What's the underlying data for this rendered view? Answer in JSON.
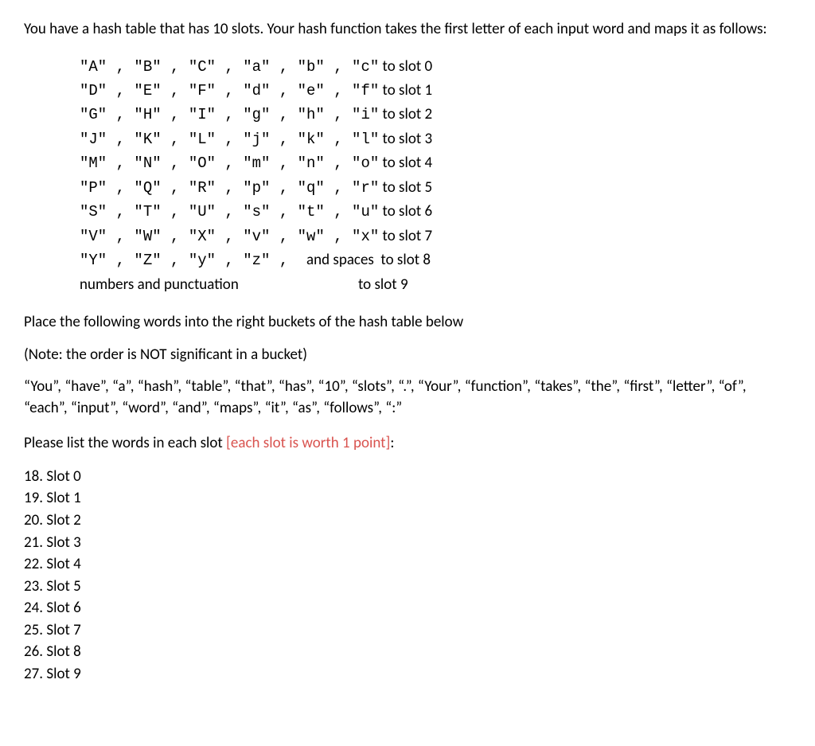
{
  "intro": "You have a hash table that has 10 slots.  Your hash function takes the first letter of each input word and maps it as follows:",
  "mapping": [
    {
      "chars": "\"A\" , \"B\" , \"C\" , \"a\" , \"b\" , \"c\"",
      "target": " to slot 0"
    },
    {
      "chars": "\"D\" , \"E\" , \"F\" , \"d\" , \"e\" , \"f\"",
      "target": " to slot 1"
    },
    {
      "chars": "\"G\" , \"H\" , \"I\" , \"g\" , \"h\" , \"i\"",
      "target": " to slot 2"
    },
    {
      "chars": "\"J\" , \"K\" , \"L\" , \"j\" , \"k\" , \"l\"",
      "target": " to slot 3"
    },
    {
      "chars": "\"M\" , \"N\" , \"O\" , \"m\" , \"n\" , \"o\"",
      "target": " to slot 4"
    },
    {
      "chars": "\"P\" , \"Q\" , \"R\" , \"p\" , \"q\" , \"r\"",
      "target": " to slot 5"
    },
    {
      "chars": "\"S\" , \"T\" , \"U\" , \"s\" , \"t\" , \"u\"",
      "target": " to slot 6"
    },
    {
      "chars": "\"V\" , \"W\" , \"X\" , \"v\" , \"w\" , \"x\"",
      "target": " to slot 7"
    }
  ],
  "mapping_row_8": {
    "chars": "\"Y\" , \"Z\" , \"y\" , \"z\" ,  ",
    "extra": "and spaces",
    "target": "  to slot 8"
  },
  "mapping_row_9": {
    "text": "numbers and punctuation",
    "target": "to slot 9"
  },
  "instruction1": "Place the following words into the right buckets of the hash table below",
  "instruction2": "(Note: the order is NOT significant in a bucket)",
  "words": "“You”, “have”, “a”, “hash”, “table”, “that”, “has”, “10”, “slots”, “.”, “Your”, “function”, “takes”, “the”, “first”, “letter”, “of”, “each”, “input”, “word”, “and”, “maps”, “it”, “as”, “follows”, “:”",
  "prompt_prefix": "Please list the words in each slot ",
  "prompt_highlight": "[each slot is worth 1 point]",
  "prompt_suffix": ":",
  "slots": [
    "18. Slot 0",
    "19. Slot 1",
    "20. Slot 2",
    "21. Slot 3",
    "22. Slot 4",
    "23. Slot 5",
    "24. Slot 6",
    "25. Slot 7",
    "26. Slot 8",
    "27. Slot 9"
  ]
}
